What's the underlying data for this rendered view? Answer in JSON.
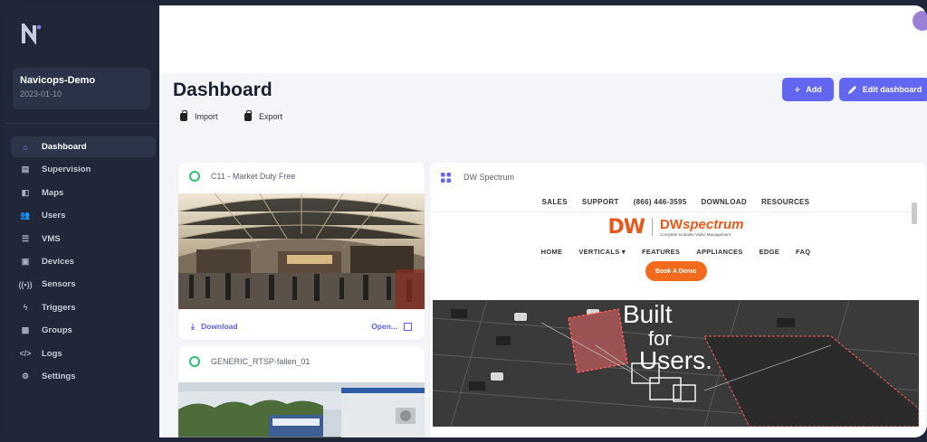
{
  "tenant": {
    "name": "Navicops-Demo",
    "date": "2023-01-10"
  },
  "sidebar": {
    "items": [
      {
        "label": "Dashboard",
        "icon": "home-icon",
        "glyph": "⌂",
        "active": true
      },
      {
        "label": "Supervision",
        "icon": "supervision-icon",
        "glyph": "▤"
      },
      {
        "label": "Maps",
        "icon": "map-icon",
        "glyph": "◧"
      },
      {
        "label": "Users",
        "icon": "users-icon",
        "glyph": "👥"
      },
      {
        "label": "VMS",
        "icon": "vms-icon",
        "glyph": "☰"
      },
      {
        "label": "Devices",
        "icon": "devices-icon",
        "glyph": "▣"
      },
      {
        "label": "Sensors",
        "icon": "sensors-icon",
        "glyph": "((•))"
      },
      {
        "label": "Triggers",
        "icon": "bolt-icon",
        "glyph": "ϟ"
      },
      {
        "label": "Groups",
        "icon": "groups-icon",
        "glyph": "▦"
      },
      {
        "label": "Logs",
        "icon": "code-icon",
        "glyph": "</>"
      },
      {
        "label": "Settings",
        "icon": "gear-icon",
        "glyph": "⚙"
      }
    ]
  },
  "header": {
    "title": "Dashboard",
    "import_label": "Import",
    "export_label": "Export",
    "add_label": "Add",
    "edit_label": "Edit dashboard"
  },
  "cards": {
    "cam1": {
      "title": "C11 - Market Duty Free",
      "download": "Download",
      "open": "Open..."
    },
    "cam2": {
      "title": "GENERIC_RTSP-fallen_01"
    },
    "web": {
      "title": "DW Spectrum",
      "top_links": [
        "SALES",
        "SUPPORT",
        "(866) 446-3595",
        "DOWNLOAD",
        "RESOURCES"
      ],
      "brand_dw": "DW",
      "brand_spectrum": "spectrum",
      "brand_sub": "Complete Scalable Video Management",
      "nav_links": [
        "HOME",
        "VERTICALS ▾",
        "FEATURES",
        "APPLIANCES",
        "EDGE",
        "FAQ"
      ],
      "demo_label": "Book A Demo",
      "hero_line1": "Built",
      "hero_line2": "for",
      "hero_line3": "Users."
    }
  },
  "colors": {
    "accent": "#6366f1",
    "status_online": "#2fbf71",
    "brand_orange": "#f26a1b"
  }
}
